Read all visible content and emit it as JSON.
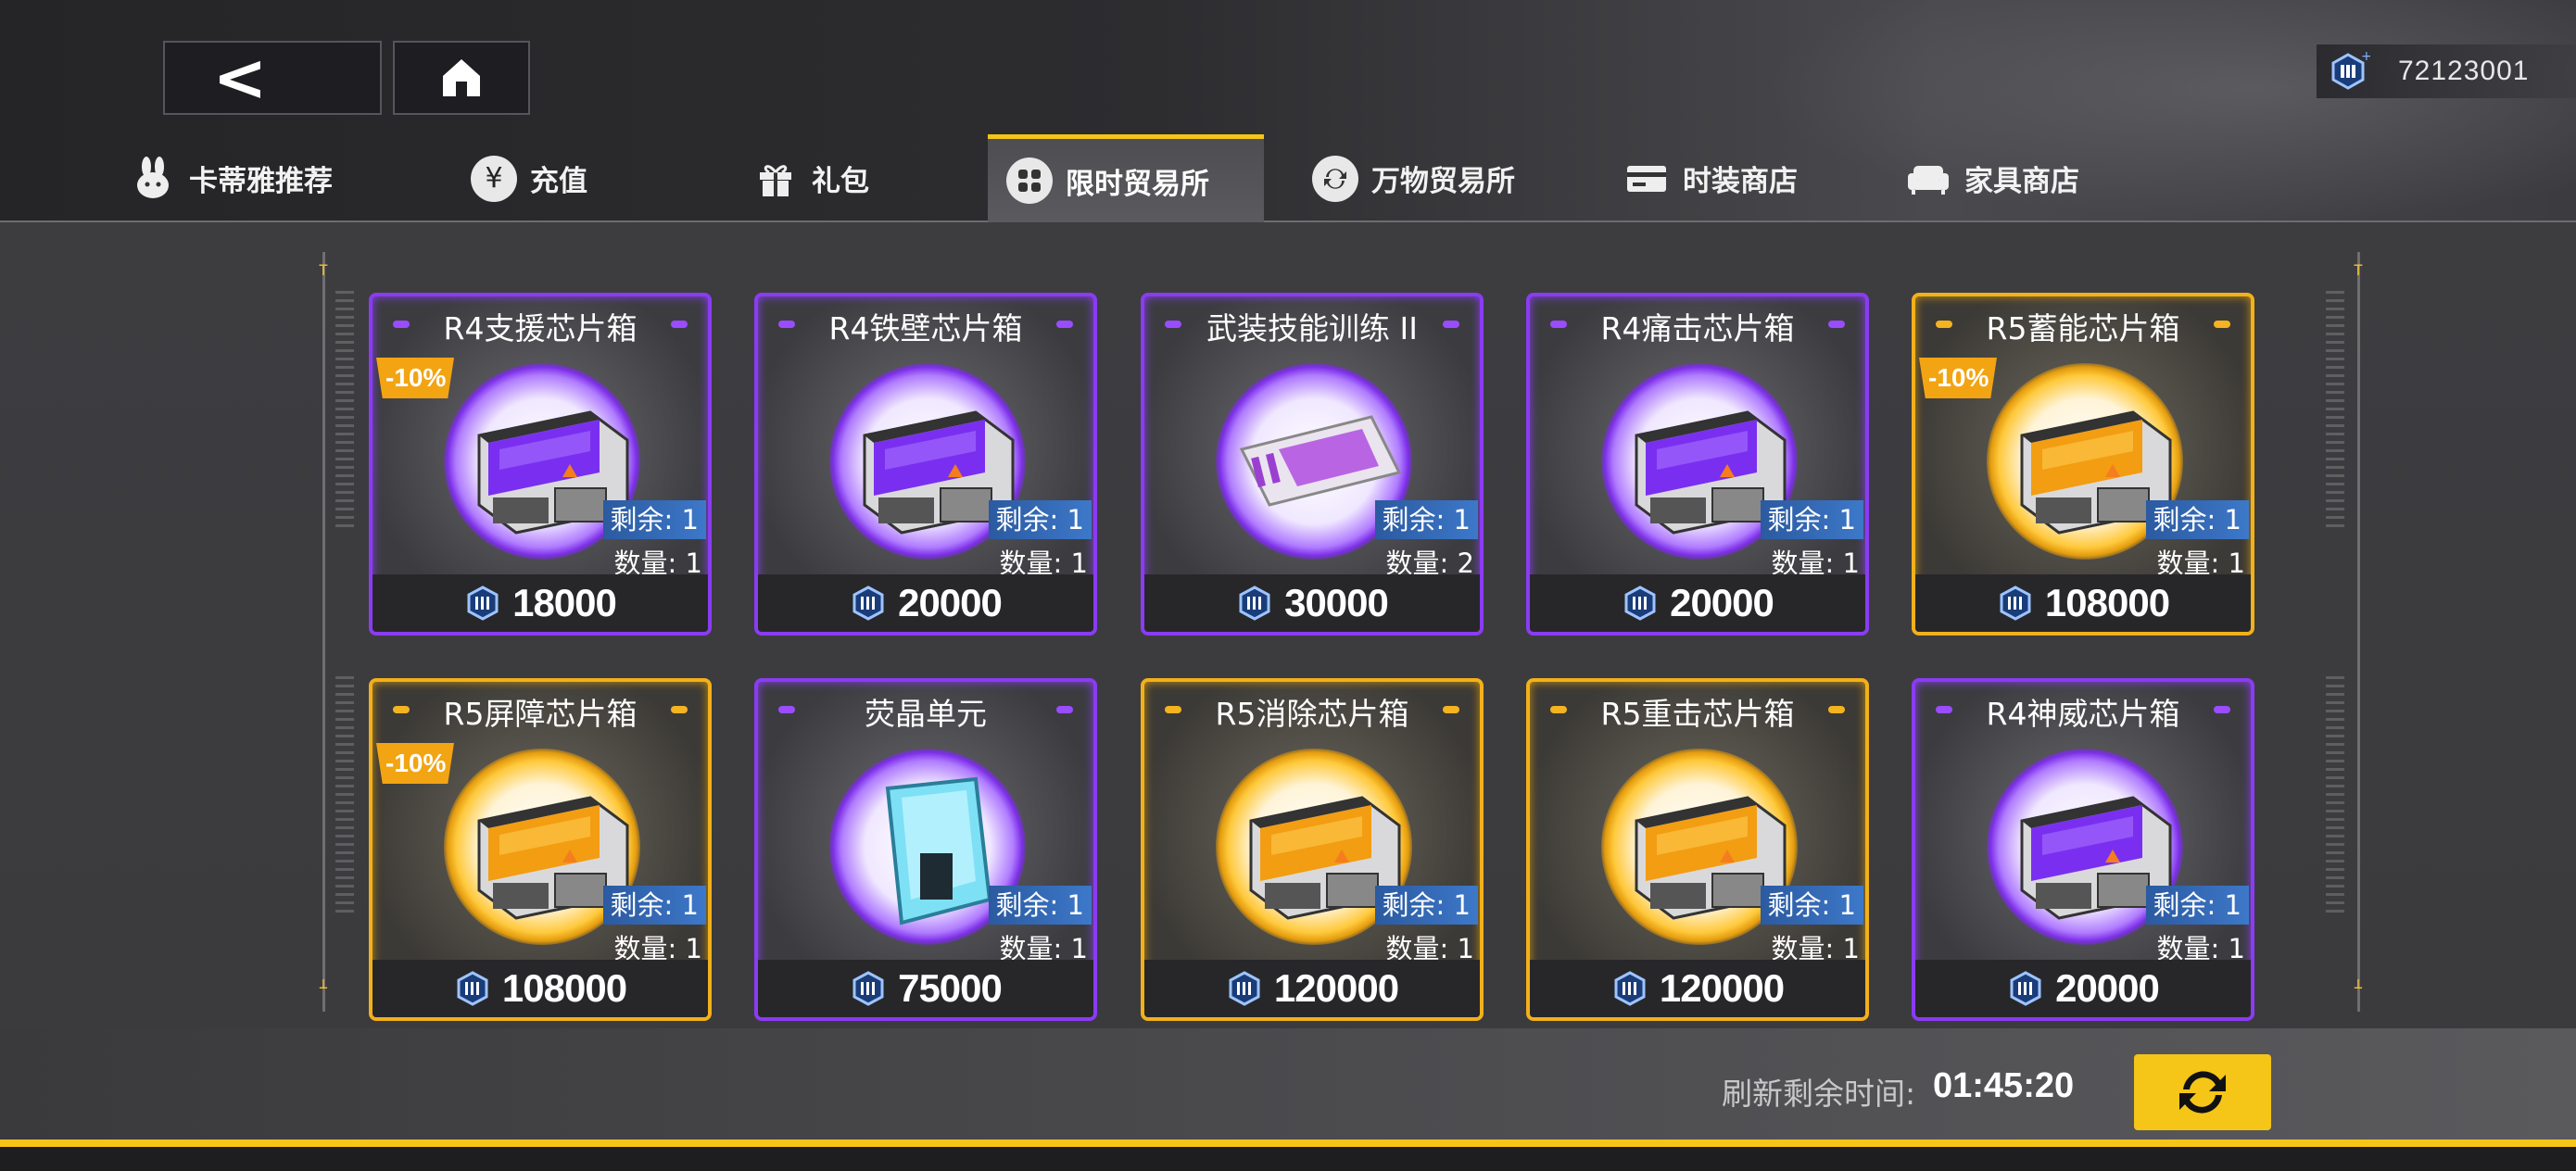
{
  "header": {
    "back_icon": "chevron-left-icon",
    "home_icon": "home-icon",
    "currency": {
      "icon": "crystal-currency-icon",
      "value": "72123001"
    }
  },
  "tabs": [
    {
      "label": "卡蒂雅推荐",
      "icon": "rabbit-icon",
      "active": false
    },
    {
      "label": "充值",
      "icon": "yen-icon",
      "active": false
    },
    {
      "label": "礼包",
      "icon": "gift-icon",
      "active": false
    },
    {
      "label": "限时贸易所",
      "icon": "grid-icon",
      "active": true
    },
    {
      "label": "万物贸易所",
      "icon": "exchange-icon",
      "active": false
    },
    {
      "label": "时装商店",
      "icon": "card-icon",
      "active": false
    },
    {
      "label": "家具商店",
      "icon": "sofa-icon",
      "active": false
    }
  ],
  "items": [
    {
      "title": "R4支援芯片箱",
      "rarity": "purple",
      "discount": "-10%",
      "remain": "剩余: 1",
      "qty": "数量: 1",
      "price": "18000",
      "icon": "chip-box-icon"
    },
    {
      "title": "R4铁壁芯片箱",
      "rarity": "purple",
      "discount": "",
      "remain": "剩余: 1",
      "qty": "数量: 1",
      "price": "20000",
      "icon": "chip-box-icon"
    },
    {
      "title": "武装技能训练 II",
      "rarity": "purple",
      "discount": "",
      "remain": "剩余: 1",
      "qty": "数量: 2",
      "price": "30000",
      "icon": "training-card-icon"
    },
    {
      "title": "R4痛击芯片箱",
      "rarity": "purple",
      "discount": "",
      "remain": "剩余: 1",
      "qty": "数量: 1",
      "price": "20000",
      "icon": "chip-box-icon"
    },
    {
      "title": "R5蓄能芯片箱",
      "rarity": "gold",
      "discount": "-10%",
      "remain": "剩余: 1",
      "qty": "数量: 1",
      "price": "108000",
      "icon": "chip-box-icon"
    },
    {
      "title": "R5屏障芯片箱",
      "rarity": "gold",
      "discount": "-10%",
      "remain": "剩余: 1",
      "qty": "数量: 1",
      "price": "108000",
      "icon": "chip-box-icon"
    },
    {
      "title": "荧晶单元",
      "rarity": "purple",
      "discount": "",
      "remain": "剩余: 1",
      "qty": "数量: 1",
      "price": "75000",
      "icon": "crystal-unit-icon"
    },
    {
      "title": "R5消除芯片箱",
      "rarity": "gold",
      "discount": "",
      "remain": "剩余: 1",
      "qty": "数量: 1",
      "price": "120000",
      "icon": "chip-box-icon"
    },
    {
      "title": "R5重击芯片箱",
      "rarity": "gold",
      "discount": "",
      "remain": "剩余: 1",
      "qty": "数量: 1",
      "price": "120000",
      "icon": "chip-box-icon"
    },
    {
      "title": "R4神威芯片箱",
      "rarity": "purple",
      "discount": "",
      "remain": "剩余: 1",
      "qty": "数量: 1",
      "price": "20000",
      "icon": "chip-box-icon"
    }
  ],
  "footer": {
    "refresh_label": "刷新剩余时间:",
    "refresh_time": "01:45:20",
    "refresh_icon": "refresh-icon"
  },
  "colors": {
    "accent": "#f5c518",
    "purple": "#8a3cf2",
    "gold": "#f2b01a",
    "remain_badge": "#3d78c9"
  }
}
